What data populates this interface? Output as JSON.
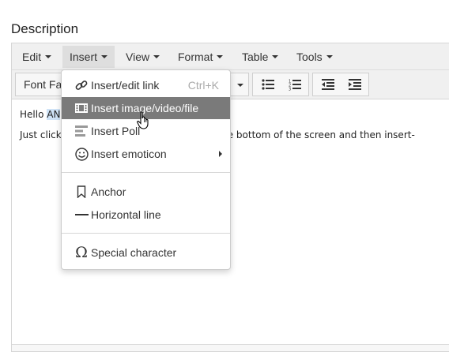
{
  "field_label": "Description",
  "menubar": {
    "items": [
      {
        "label": "Edit"
      },
      {
        "label": "Insert"
      },
      {
        "label": "View"
      },
      {
        "label": "Format"
      },
      {
        "label": "Table"
      },
      {
        "label": "Tools"
      }
    ]
  },
  "toolbar": {
    "font_family_label": "Font Fa"
  },
  "content": {
    "line1_prefix": "Hello ",
    "line1_highlight": "AN",
    "line2_prefix": "Just click",
    "line2_suffix": "e bottom of the screen and then insert-"
  },
  "insert_menu": {
    "items": [
      {
        "label": "Insert/edit link",
        "shortcut": "Ctrl+K",
        "icon": "link-icon"
      },
      {
        "label": "Insert image/video/file",
        "icon": "film-icon"
      },
      {
        "label": "Insert Poll",
        "icon": "poll-icon"
      },
      {
        "label": "Insert emoticon",
        "icon": "smiley-icon"
      },
      {
        "label": "Anchor",
        "icon": "bookmark-icon"
      },
      {
        "label": "Horizontal line",
        "icon": "horizontal-line-icon"
      },
      {
        "label": "Special character",
        "icon": "omega-icon"
      }
    ],
    "hover_color": "#7a7a7a"
  }
}
